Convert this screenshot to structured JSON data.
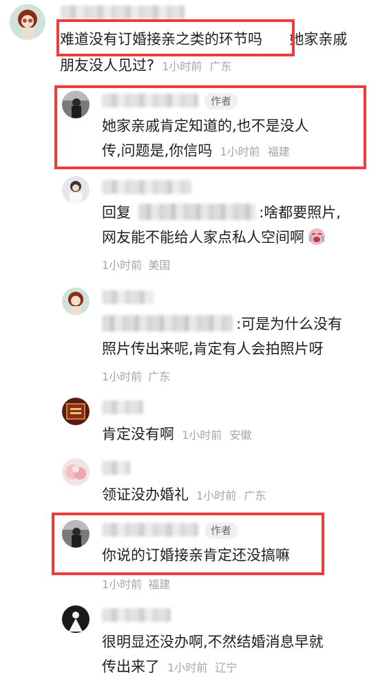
{
  "comments": [
    {
      "text_highlight": "难道没有订婚接亲之类的环节吗",
      "text_line1_rest": "她家亲戚",
      "text_line2": "朋友没人见过?",
      "time": "1小时前",
      "location": "广东"
    },
    {
      "badge": "作者",
      "text_line1": "她家亲戚肯定知道的,也不是没人",
      "text_line2": "传,问题是,你信吗",
      "time": "1小时前",
      "location": "福建"
    },
    {
      "reply_prefix": "回复",
      "text_line1_rest": ":啥都要照片,",
      "text_line2": "网友能不能给人家点私人空间啊",
      "emoji": "crying-emoji",
      "time": "1小时前",
      "location": "美国"
    },
    {
      "text_line1_rest": ":可是为什么没有",
      "text_line2": "照片传出来呢,肯定有人会拍照片呀",
      "time": "1小时前",
      "location": "广东"
    },
    {
      "text": "肯定没有啊",
      "time": "1小时前",
      "location": "安徽"
    },
    {
      "text": "领证没办婚礼",
      "time": "1小时前",
      "location": "广东"
    },
    {
      "badge": "作者",
      "text": "你说的订婚接亲肯定还没搞嘛",
      "time": "1小时前",
      "location": "福建"
    },
    {
      "text_line1": "很明显还没办啊,不然结婚消息早就",
      "text_line2": "传出来了",
      "time": "1小时前",
      "location": "辽宁"
    }
  ],
  "colors": {
    "highlight": "#ee3b3b",
    "meta": "#a6a6a6",
    "text": "#1f1f1f"
  }
}
